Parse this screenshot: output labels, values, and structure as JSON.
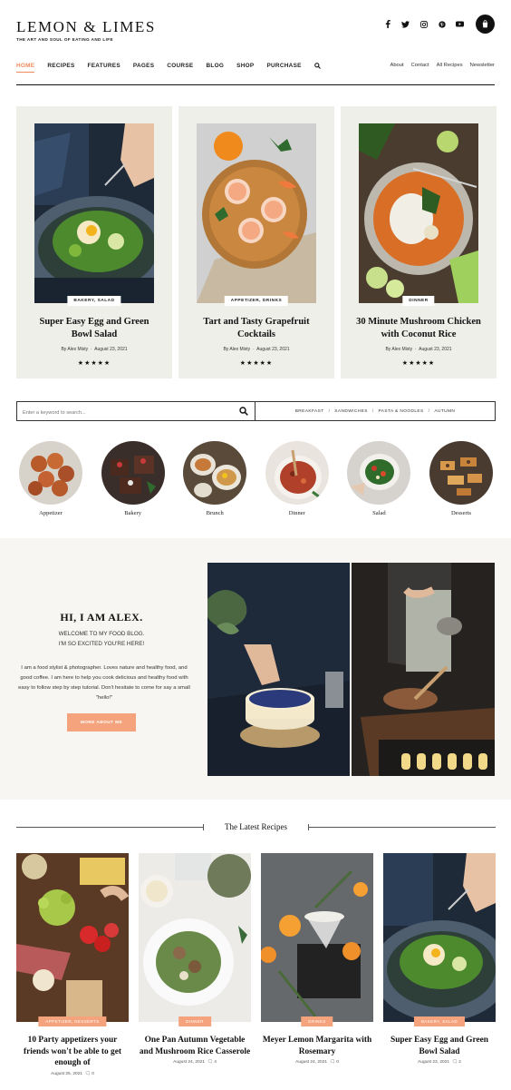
{
  "brand": {
    "logo": "LEMON & LIMES",
    "tagline": "THE ART AND SOUL OF EATING AND LIFE"
  },
  "social": [
    {
      "icon": "facebook-icon",
      "glyph": "f"
    },
    {
      "icon": "twitter-icon",
      "glyph": "🐦"
    },
    {
      "icon": "instagram-icon",
      "glyph": "◎"
    },
    {
      "icon": "pinterest-icon",
      "glyph": "℗"
    },
    {
      "icon": "youtube-icon",
      "glyph": "▶"
    }
  ],
  "nav": {
    "items": [
      "HOME",
      "RECIPES",
      "FEATURES",
      "PAGES",
      "COURSE",
      "BLOG",
      "SHOP",
      "PURCHASE"
    ],
    "active": "HOME",
    "secondary": [
      "About",
      "Contact",
      "All Recipes",
      "Newsletter"
    ]
  },
  "featured": [
    {
      "badge": "BAKERY, SALAD",
      "title": "Super Easy Egg and Green Bowl Salad",
      "author": "By Alex Misty",
      "date": "August 23, 2021",
      "stars": "★★★★★"
    },
    {
      "badge": "APPETIZER, DRINKS",
      "title": "Tart and Tasty Grapefruit Cocktails",
      "author": "By Alex Misty",
      "date": "August 23, 2021",
      "stars": "★★★★★"
    },
    {
      "badge": "DINNER",
      "title": "30 Minute Mushroom Chicken with Coconut Rice",
      "author": "By Alex Misty",
      "date": "August 23, 2021",
      "stars": "★★★★★"
    }
  ],
  "search": {
    "placeholder": "Enter a keyword to search...",
    "quicklinks": [
      "BREAKFAST",
      "SANDWICHES",
      "PASTA & NOODLES",
      "AUTUMN"
    ]
  },
  "categories": [
    "Appetizer",
    "Bakery",
    "Brunch",
    "Dinner",
    "Salad",
    "Desserts"
  ],
  "about": {
    "heading": "HI, I AM ALEX.",
    "welcome_1": "WELCOME TO MY FOOD BLOG.",
    "welcome_2": "I'M SO EXCITED YOU'RE HERE!",
    "bio": "I am a food stylist & photographer. Loves nature and healthy food, and good coffee. I am here to help you cook delicious and healthy food with easy to follow step by step tutorial. Don't hesitate to come for say a small \"hello!\"",
    "button": "MORE ABOUT ME"
  },
  "latest": {
    "heading": "The Latest Recipes",
    "items": [
      {
        "badge": "APPETIZER, DESSERTS",
        "title": "10 Party appetizers your friends won't be able to get enough of",
        "date": "August 25, 2021",
        "comments": "0"
      },
      {
        "badge": "DINNER",
        "title": "One Pan Autumn Vegetable and Mushroom Rice Casserole",
        "date": "August 24, 2021",
        "comments": "4"
      },
      {
        "badge": "DRINKS",
        "title": "Meyer Lemon Margarita with Rosemary",
        "date": "August 24, 2021",
        "comments": "0"
      },
      {
        "badge": "BAKERY, SALAD",
        "title": "Super Easy Egg and Green Bowl Salad",
        "date": "August 23, 2021",
        "comments": "2"
      }
    ]
  },
  "colors": {
    "accent": "#f08a5d",
    "button": "#f5a37c",
    "card_bg": "#efefea",
    "about_bg": "#f7f6f3"
  }
}
